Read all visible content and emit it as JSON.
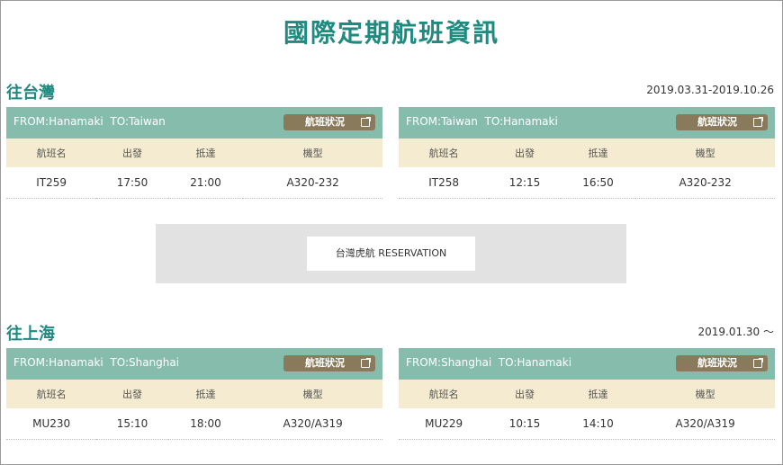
{
  "page": {
    "title": "國際定期航班資訊"
  },
  "sections": [
    {
      "title": "往台灣",
      "date": "2019.03.31-2019.10.26",
      "cards": [
        {
          "route": "FROM:Hanamaki  TO:Taiwan",
          "status_label": "航班狀況",
          "headers": [
            "航班名",
            "出發",
            "抵達",
            "機型"
          ],
          "row": [
            "IT259",
            "17:50",
            "21:00",
            "A320-232"
          ]
        },
        {
          "route": "FROM:Taiwan  TO:Hanamaki",
          "status_label": "航班狀況",
          "headers": [
            "航班名",
            "出發",
            "抵達",
            "機型"
          ],
          "row": [
            "IT258",
            "12:15",
            "16:50",
            "A320-232"
          ]
        }
      ]
    },
    {
      "title": "往上海",
      "date": "2019.01.30 ～",
      "cards": [
        {
          "route": "FROM:Hanamaki  TO:Shanghai",
          "status_label": "航班狀況",
          "headers": [
            "航班名",
            "出發",
            "抵達",
            "機型"
          ],
          "row": [
            "MU230",
            "15:10",
            "18:00",
            "A320/A319"
          ]
        },
        {
          "route": "FROM:Shanghai  TO:Hanamaki",
          "status_label": "航班狀況",
          "headers": [
            "航班名",
            "出發",
            "抵達",
            "機型"
          ],
          "row": [
            "MU229",
            "10:15",
            "14:10",
            "A320/A319"
          ]
        }
      ]
    }
  ],
  "promo": {
    "label": "台灣虎航 RESERVATION"
  },
  "icons": {
    "status_button_icon": "external-link-icon"
  },
  "colors": {
    "accent": "#1f8a7f",
    "card_header": "#86bcac",
    "table_header": "#f4ebd0",
    "button": "#8a7a5c"
  }
}
